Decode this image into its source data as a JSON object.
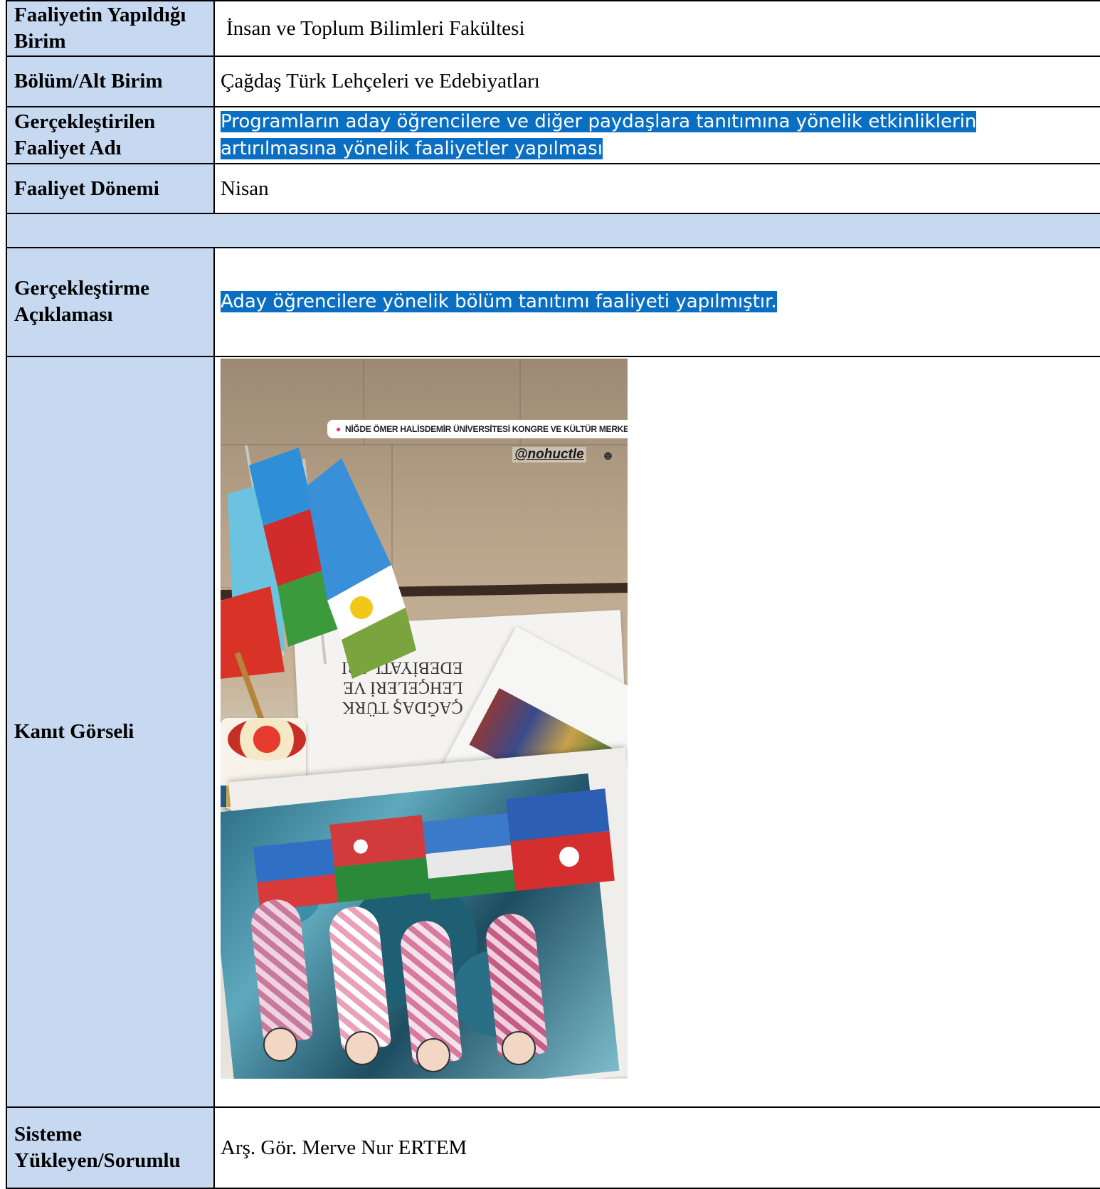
{
  "rows": [
    {
      "label": "Faaliyetin Yapıldığı Birim",
      "value": "İnsan ve Toplum Bilimleri Fakültesi"
    },
    {
      "label": "Bölüm/Alt Birim",
      "value": "Çağdaş Türk Lehçeleri ve Edebiyatları"
    },
    {
      "label": "Gerçekleştirilen Faaliyet Adı",
      "value": "Programların aday öğrencilere ve diğer paydaşlara tanıtımına yönelik etkinliklerin artırılmasına yönelik faaliyetler yapılması"
    },
    {
      "label": "Faaliyet Dönemi",
      "value": "Nisan"
    },
    {
      "label": "Gerçekleştirme Açıklaması",
      "value": "Aday öğrencilere yönelik bölüm tanıtımı faaliyeti yapılmıştır."
    },
    {
      "label": "Kanıt Görseli"
    },
    {
      "label": "Sisteme Yükleyen/Sorumlu",
      "value": "Arş. Gör. Merve Nur ERTEM"
    }
  ],
  "photo": {
    "location": "NİĞDE ÖMER HALİSDEMİR ÜNİVERSİTESİ KONGRE VE KÜLTÜR MERKEZİ",
    "handle": "@nohuctle",
    "sign_text": "ÇAĞDAŞ TÜRK\nLEHÇELERİ VE\nEDEBİYATLARI"
  },
  "colors": {
    "label_bg": "#c6d9f1",
    "highlight_bg": "#0a6fc2",
    "highlight_text": "#ffffff",
    "border": "#000000"
  }
}
